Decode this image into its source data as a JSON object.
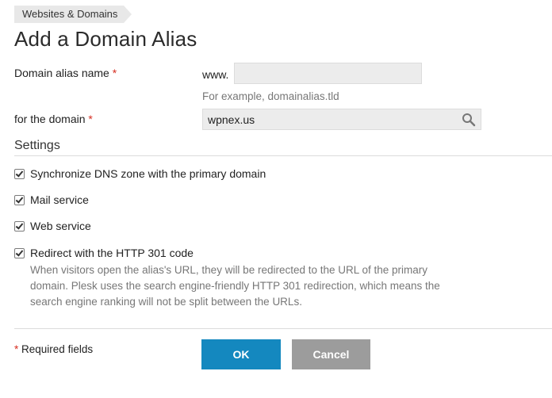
{
  "breadcrumb": {
    "label": "Websites & Domains"
  },
  "page_title": "Add a Domain Alias",
  "form": {
    "alias_label": "Domain alias name",
    "required_mark": "*",
    "www_prefix": "www.",
    "alias_value": "",
    "alias_hint": "For example, domainalias.tld",
    "domain_label": "for the domain",
    "domain_value": "wpnex.us"
  },
  "settings": {
    "title": "Settings",
    "options": [
      {
        "label": "Synchronize DNS zone with the primary domain",
        "checked": true
      },
      {
        "label": "Mail service",
        "checked": true
      },
      {
        "label": "Web service",
        "checked": true
      },
      {
        "label": "Redirect with the HTTP 301 code",
        "checked": true
      }
    ],
    "redirect_help": "When visitors open the alias's URL, they will be redirected to the URL of the primary domain. Plesk uses the search engine-friendly HTTP 301 redirection, which means the search engine ranking will not be split between the URLs."
  },
  "footer": {
    "required_note": "Required fields",
    "ok_label": "OK",
    "cancel_label": "Cancel"
  },
  "colors": {
    "primary_button": "#1488bf",
    "cancel_button": "#9c9c9c",
    "required": "#d62d20"
  },
  "icons": {
    "domain_search": "search-icon"
  }
}
